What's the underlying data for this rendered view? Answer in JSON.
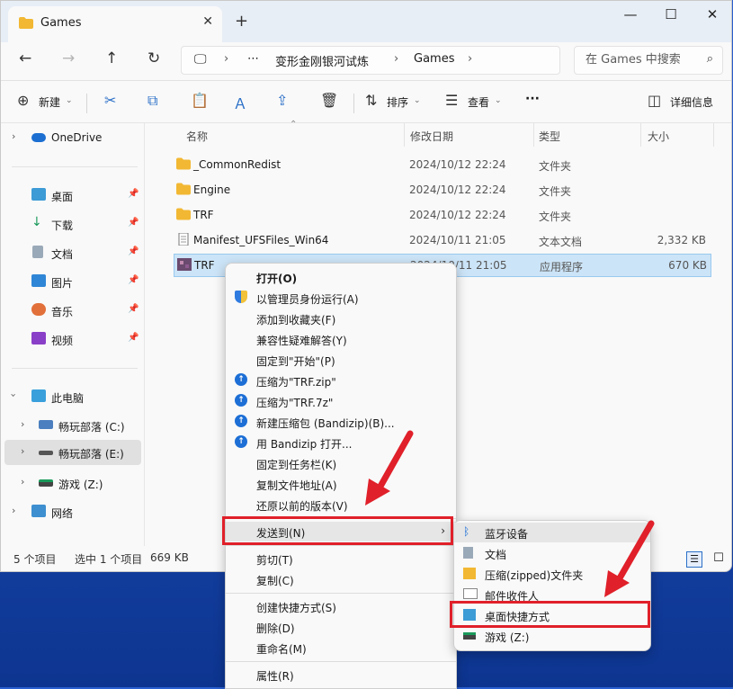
{
  "tab": {
    "title": "Games"
  },
  "window": {
    "minimize": "—",
    "maximize": "☐",
    "close": "✕",
    "newtab": "+"
  },
  "address": {
    "crumbs": [
      "⋯",
      "变形金刚银河试炼",
      "Games"
    ],
    "search_placeholder": "在 Games 中搜索"
  },
  "toolbar": {
    "new": "新建",
    "sort": "排序",
    "view": "查看",
    "more": "···",
    "details": "详细信息"
  },
  "sidebar": {
    "items": [
      {
        "label": "OneDrive"
      },
      {
        "label": "桌面"
      },
      {
        "label": "下载"
      },
      {
        "label": "文档"
      },
      {
        "label": "图片"
      },
      {
        "label": "音乐"
      },
      {
        "label": "视频"
      },
      {
        "label": "此电脑"
      },
      {
        "label": "畅玩部落 (C:)"
      },
      {
        "label": "畅玩部落 (E:)"
      },
      {
        "label": "游戏 (Z:)"
      },
      {
        "label": "网络"
      }
    ]
  },
  "columns": {
    "name": "名称",
    "date": "修改日期",
    "type": "类型",
    "size": "大小"
  },
  "files": [
    {
      "name": "_CommonRedist",
      "date": "2024/10/12 22:24",
      "type": "文件夹",
      "size": ""
    },
    {
      "name": "Engine",
      "date": "2024/10/12 22:24",
      "type": "文件夹",
      "size": ""
    },
    {
      "name": "TRF",
      "date": "2024/10/12 22:24",
      "type": "文件夹",
      "size": ""
    },
    {
      "name": "Manifest_UFSFiles_Win64",
      "date": "2024/10/11 21:05",
      "type": "文本文档",
      "size": "2,332 KB"
    },
    {
      "name": "TRF",
      "date": "2024/10/11 21:05",
      "type": "应用程序",
      "size": "670 KB"
    }
  ],
  "status": {
    "count": "5 个项目",
    "selected": "选中 1 个项目",
    "size": "669 KB"
  },
  "context_menu": [
    "打开(O)",
    "以管理员身份运行(A)",
    "添加到收藏夹(F)",
    "兼容性疑难解答(Y)",
    "固定到\"开始\"(P)",
    "压缩为\"TRF.zip\"",
    "压缩为\"TRF.7z\"",
    "新建压缩包 (Bandizip)(B)...",
    "用 Bandizip 打开...",
    "固定到任务栏(K)",
    "复制文件地址(A)",
    "还原以前的版本(V)",
    "发送到(N)",
    "剪切(T)",
    "复制(C)",
    "创建快捷方式(S)",
    "删除(D)",
    "重命名(M)",
    "属性(R)"
  ],
  "submenu": [
    "蓝牙设备",
    "文档",
    "压缩(zipped)文件夹",
    "邮件收件人",
    "桌面快捷方式",
    "游戏 (Z:)"
  ],
  "colors": {
    "accent": "#2b6fc7",
    "highlight": "#e0202a",
    "selection": "#cce4f7"
  }
}
